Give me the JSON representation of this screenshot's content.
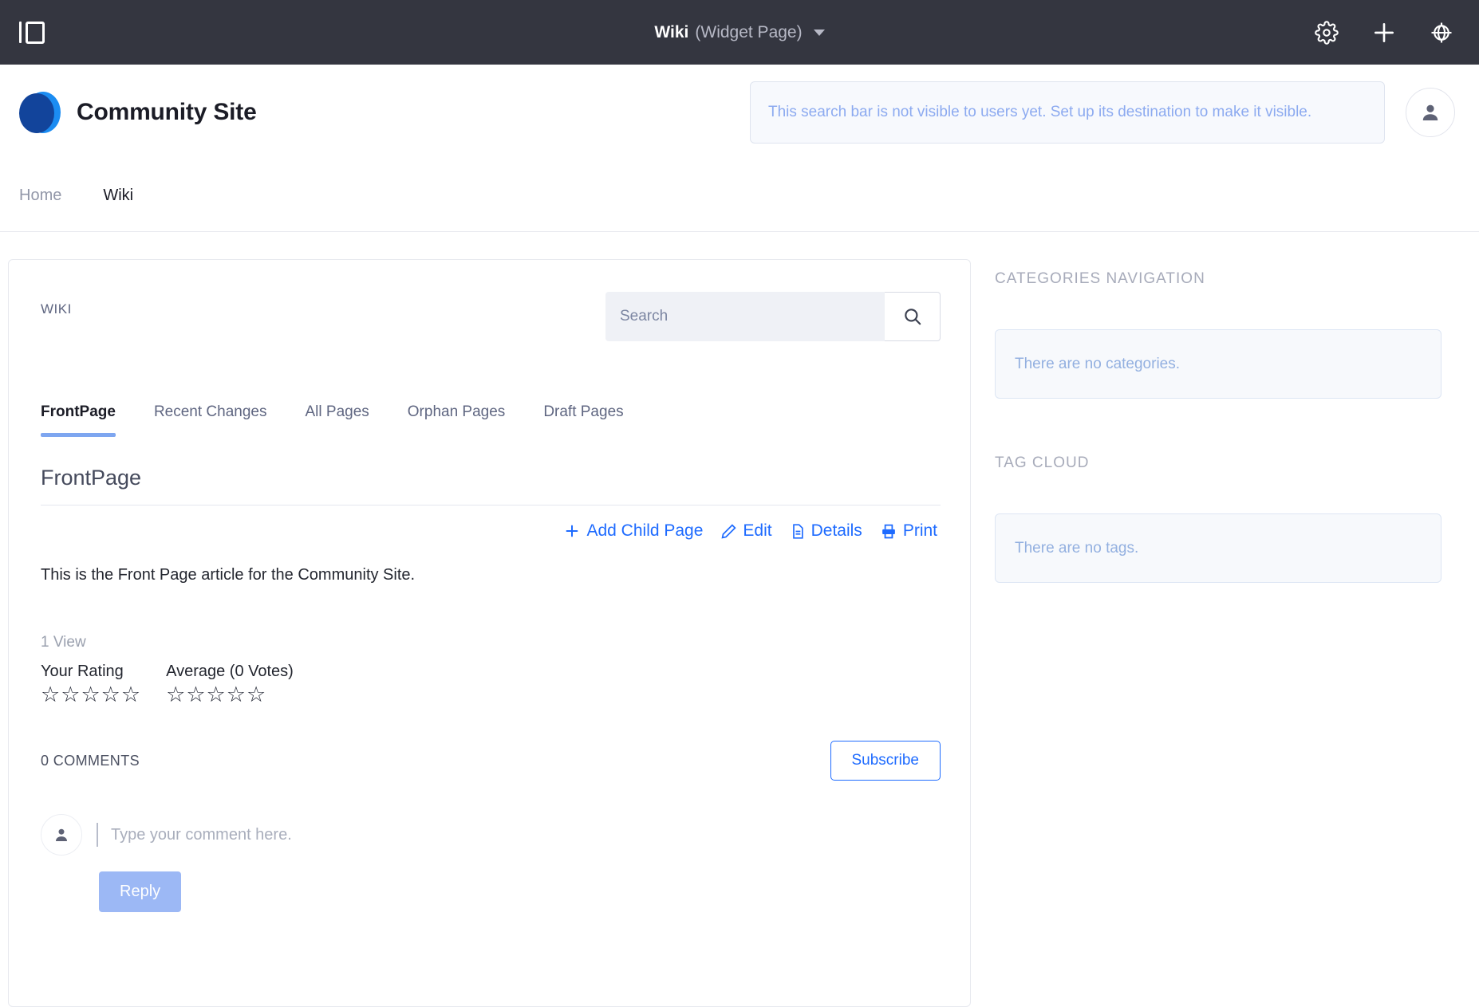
{
  "topbar": {
    "sidebar_toggle_icon": "sidebar-toggle-icon",
    "title_main": "Wiki",
    "title_sub": "(Widget Page)",
    "dropdown_icon": "chevron-down-icon",
    "actions": [
      {
        "icon": "gear-icon",
        "label": "Settings"
      },
      {
        "icon": "plus-icon",
        "label": "Add"
      },
      {
        "icon": "globe-target-icon",
        "label": "Site"
      }
    ],
    "background_color": "#343640"
  },
  "header": {
    "brand_name": "Community Site",
    "logo_icon": "overlapping-circles-logo",
    "logo_color_front": "#12449b",
    "logo_color_back": "#1b8cf2",
    "search_notice": "This search bar is not visible to users yet. Set up its destination to make it visible.",
    "avatar_icon": "user-avatar-icon"
  },
  "nav": {
    "items": [
      {
        "label": "Home",
        "active": false
      },
      {
        "label": "Wiki",
        "active": true
      }
    ]
  },
  "wiki": {
    "section_label": "WIKI",
    "search_placeholder": "Search",
    "search_value": "",
    "search_icon": "magnifier-icon",
    "tabs": [
      {
        "label": "FrontPage",
        "active": true
      },
      {
        "label": "Recent Changes",
        "active": false
      },
      {
        "label": "All Pages",
        "active": false
      },
      {
        "label": "Orphan Pages",
        "active": false
      },
      {
        "label": "Draft Pages",
        "active": false
      }
    ],
    "active_tab_color": "#7ea6f0",
    "article": {
      "title": "FrontPage",
      "body": "This is the Front Page article for the Community Site.",
      "views": "1 View"
    },
    "actions": [
      {
        "label": "Add Child Page",
        "icon": "plus-icon"
      },
      {
        "label": "Edit",
        "icon": "pencil-icon"
      },
      {
        "label": "Details",
        "icon": "document-icon"
      },
      {
        "label": "Print",
        "icon": "printer-icon"
      }
    ],
    "action_color": "#1e6bff",
    "ratings": [
      {
        "label": "Your Rating",
        "stars": 0,
        "max": 5
      },
      {
        "label": "Average (0 Votes)",
        "stars": 0,
        "max": 5
      }
    ],
    "star_empty_glyph": "☆",
    "comments": {
      "count_label": "0 COMMENTS",
      "subscribe_label": "Subscribe",
      "input_placeholder": "Type your comment here.",
      "input_value": "",
      "reply_label": "Reply",
      "avatar_icon": "user-avatar-icon"
    }
  },
  "sidebar": {
    "sections": [
      {
        "title": "CATEGORIES NAVIGATION",
        "empty_text": "There are no categories."
      },
      {
        "title": "TAG CLOUD",
        "empty_text": "There are no tags."
      }
    ]
  }
}
